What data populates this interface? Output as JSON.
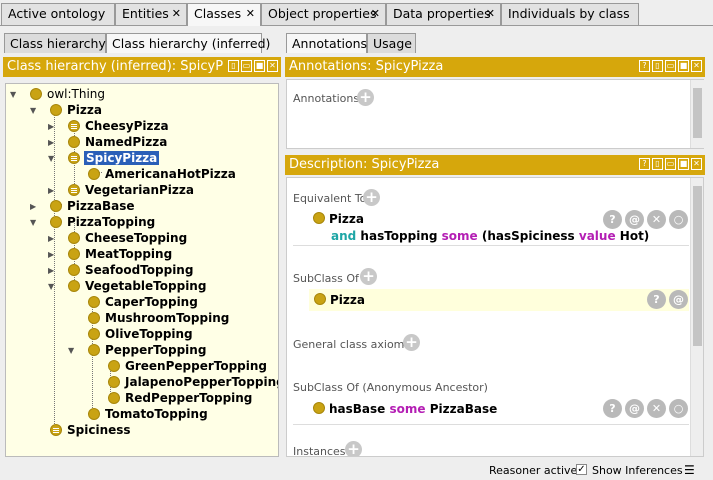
{
  "tabs": [
    {
      "label": "Active ontology",
      "closable": false
    },
    {
      "label": "Entities",
      "closable": true
    },
    {
      "label": "Classes",
      "closable": true,
      "active": true
    },
    {
      "label": "Object properties",
      "closable": true
    },
    {
      "label": "Data properties",
      "closable": true
    },
    {
      "label": "Individuals by class",
      "closable": false
    }
  ],
  "left": {
    "subtabs": [
      "Class hierarchy",
      "Class hierarchy (inferred)"
    ],
    "title": "Class hierarchy (inferred): SpicyP",
    "tree": [
      {
        "label": "owl:Thing"
      },
      {
        "label": "Pizza"
      },
      {
        "label": "CheesyPizza"
      },
      {
        "label": "NamedPizza"
      },
      {
        "label": "SpicyPizza"
      },
      {
        "label": "AmericanaHotPizza"
      },
      {
        "label": "VegetarianPizza"
      },
      {
        "label": "PizzaBase"
      },
      {
        "label": "PizzaTopping"
      },
      {
        "label": "CheeseTopping"
      },
      {
        "label": "MeatTopping"
      },
      {
        "label": "SeafoodTopping"
      },
      {
        "label": "VegetableTopping"
      },
      {
        "label": "CaperTopping"
      },
      {
        "label": "MushroomTopping"
      },
      {
        "label": "OliveTopping"
      },
      {
        "label": "PepperTopping"
      },
      {
        "label": "GreenPepperTopping"
      },
      {
        "label": "JalapenoPepperTopping"
      },
      {
        "label": "RedPepperTopping"
      },
      {
        "label": "TomatoTopping"
      },
      {
        "label": "Spiciness"
      }
    ]
  },
  "right": {
    "subtabs": [
      "Annotations",
      "Usage"
    ],
    "annotations_title": "Annotations: SpicyPizza",
    "annotations_label": "Annotations",
    "description_title": "Description: SpicyPizza",
    "equivalent_to": "Equivalent To",
    "eq_class": "Pizza",
    "eq_and": "and",
    "eq_prop": "hasTopping",
    "eq_some": "some",
    "eq_open": "(hasSpiciness",
    "eq_value": "value",
    "eq_hot": "Hot)",
    "subclass_of": "SubClass Of",
    "subclass_item": "Pizza",
    "general_axioms": "General class axioms",
    "anon_ancestor": "SubClass Of (Anonymous Ancestor)",
    "anc_prop": "hasBase",
    "anc_some": "some",
    "anc_class": "PizzaBase",
    "instances": "Instances"
  },
  "status": {
    "reasoner": "Reasoner active",
    "show_inferences": "Show Inferences",
    "show_inferences_checked": true
  }
}
